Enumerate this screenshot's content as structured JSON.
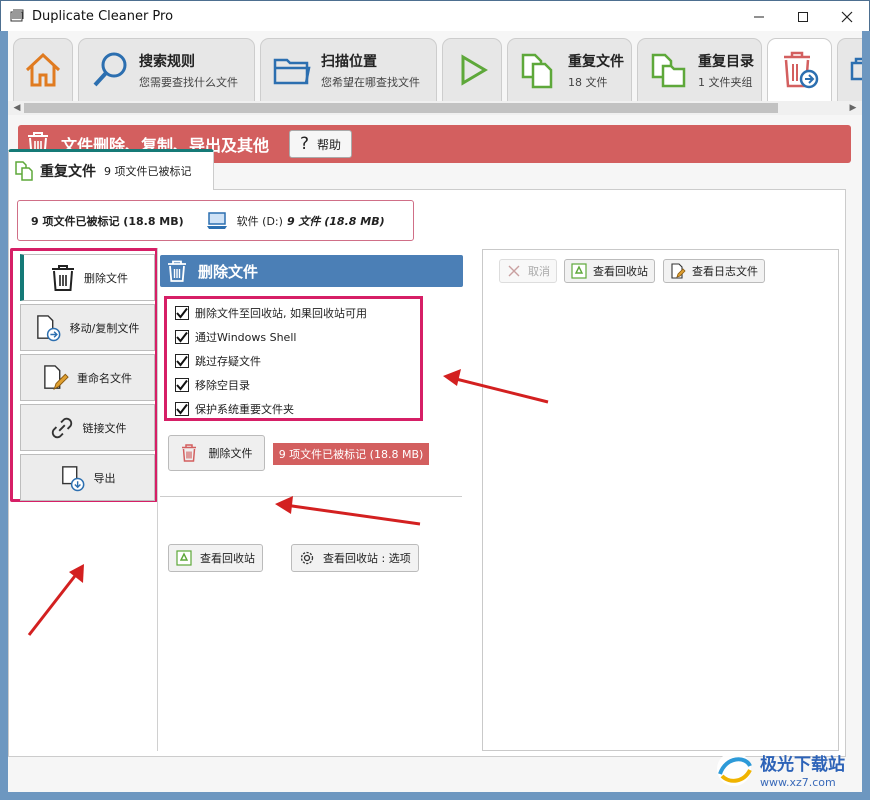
{
  "window": {
    "title": "Duplicate Cleaner Pro"
  },
  "ribbon": {
    "tabs": [
      {
        "main": "",
        "sub": ""
      },
      {
        "main": "搜索规则",
        "sub": "您需要查找什么文件"
      },
      {
        "main": "扫描位置",
        "sub": "您希望在哪查找文件"
      },
      {
        "main": "",
        "sub": ""
      },
      {
        "main": "重复文件",
        "sub": "18 文件"
      },
      {
        "main": "重复目录",
        "sub": "1 文件夹组"
      }
    ]
  },
  "section": {
    "title": "文件删除、复制、导出及其他",
    "help_label": "帮助"
  },
  "file_tab": {
    "title": "重复文件",
    "subtitle": "9 项文件已被标记"
  },
  "summary": {
    "marked": "9 项文件已被标记 (18.8 MB)",
    "drive": "软件 (D:)",
    "drive_files": "9 文件 (18.8 MB)"
  },
  "leftnav": {
    "items": [
      {
        "label": "删除文件",
        "icon": "trash-icon"
      },
      {
        "label": "移动/复制文件",
        "icon": "move-file-icon"
      },
      {
        "label": "重命名文件",
        "icon": "rename-file-icon"
      },
      {
        "label": "链接文件",
        "icon": "link-icon"
      },
      {
        "label": "导出",
        "icon": "export-icon"
      }
    ]
  },
  "delete_panel": {
    "title": "删除文件",
    "options": [
      {
        "label": "删除文件至回收站, 如果回收站可用",
        "checked": true
      },
      {
        "label": "通过Windows Shell",
        "checked": true
      },
      {
        "label": "跳过存疑文件",
        "checked": true
      },
      {
        "label": "移除空目录",
        "checked": true
      },
      {
        "label": "保护系统重要文件夹",
        "checked": true
      }
    ],
    "delete_button": "删除文件",
    "marked_badge": "9 项文件已被标记 (18.8 MB)",
    "view_recycle": "查看回收站",
    "recycle_options": "查看回收站 : 选项"
  },
  "right_panel": {
    "cancel": "取消",
    "view_recycle": "查看回收站",
    "view_log": "查看日志文件"
  },
  "watermark": {
    "name": "极光下载站",
    "url": "www.xz7.com"
  },
  "colors": {
    "accent_red": "#d35f5f",
    "header_blue": "#4b7fb6",
    "highlight_pink": "#d61f66",
    "arrow_red": "#d32020",
    "teal": "#157a77"
  }
}
